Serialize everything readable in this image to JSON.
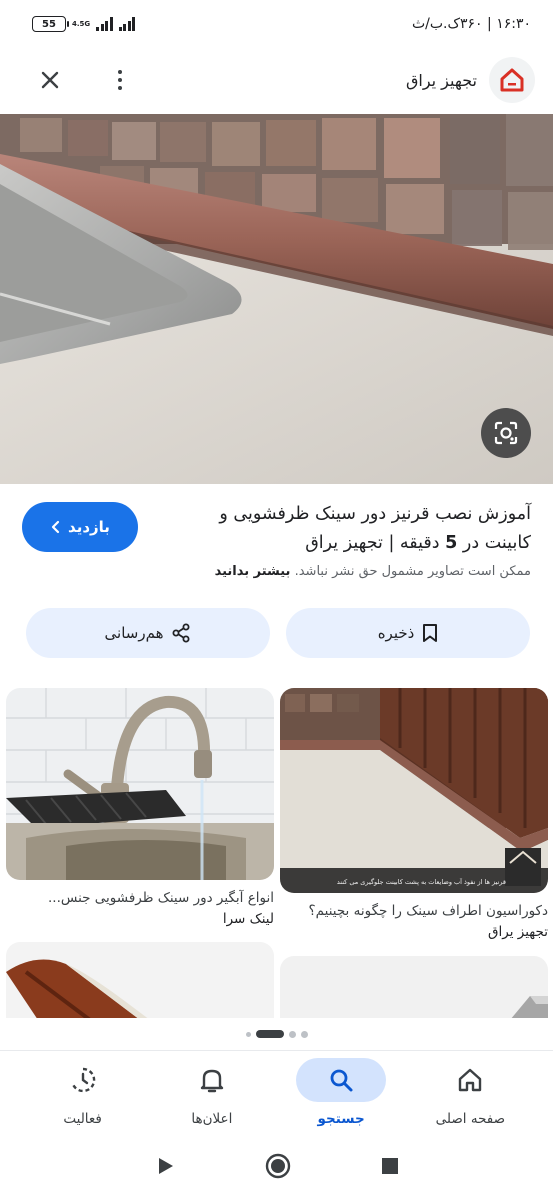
{
  "status_bar": {
    "battery": "55",
    "network": "4.5G",
    "time": "۱۶:۳۰ | ۳۶۰ک.ب/ث"
  },
  "topbar": {
    "site_name": "تجهیز یراق",
    "close_icon": "close-icon",
    "more_icon": "more-vert-icon"
  },
  "hero": {
    "lens_icon": "google-lens-icon"
  },
  "result": {
    "title_pre": "آموزش نصب قرنیز دور سینک ظرفشویی و کابینت در ",
    "title_num": "5",
    "title_post": " دقیقه | تجهیز یراق",
    "copyright": "ممکن است تصاویر مشمول حق نشر نباشد.",
    "learn_more": "بیشتر بدانید",
    "visit_label": "بازدید"
  },
  "actions": {
    "share_label": "هم‌رسانی",
    "save_label": "ذخیره"
  },
  "related": [
    {
      "caption": "دکوراسیون اطراف سینک را چگونه بچینیم؟",
      "source": "تجهیز یراق",
      "overlay_text": "قرنیز ها از نفوذ آب وضایعات به پشت کابینت جلوگیری می کنند"
    },
    {
      "caption": "انواع آبگیر دور سینک ظرفشویی جنس...",
      "source": "لینک سرا"
    }
  ],
  "bottom_nav": [
    {
      "label": "صفحه اصلی",
      "icon": "home-icon"
    },
    {
      "label": "جستجو",
      "icon": "search-icon"
    },
    {
      "label": "اعلان‌ها",
      "icon": "bell-icon"
    },
    {
      "label": "فعالیت",
      "icon": "history-icon"
    }
  ],
  "colors": {
    "accent": "#1a73e8",
    "pill_bg": "#e8f0fe",
    "active_nav_bg": "#d3e3fd"
  }
}
